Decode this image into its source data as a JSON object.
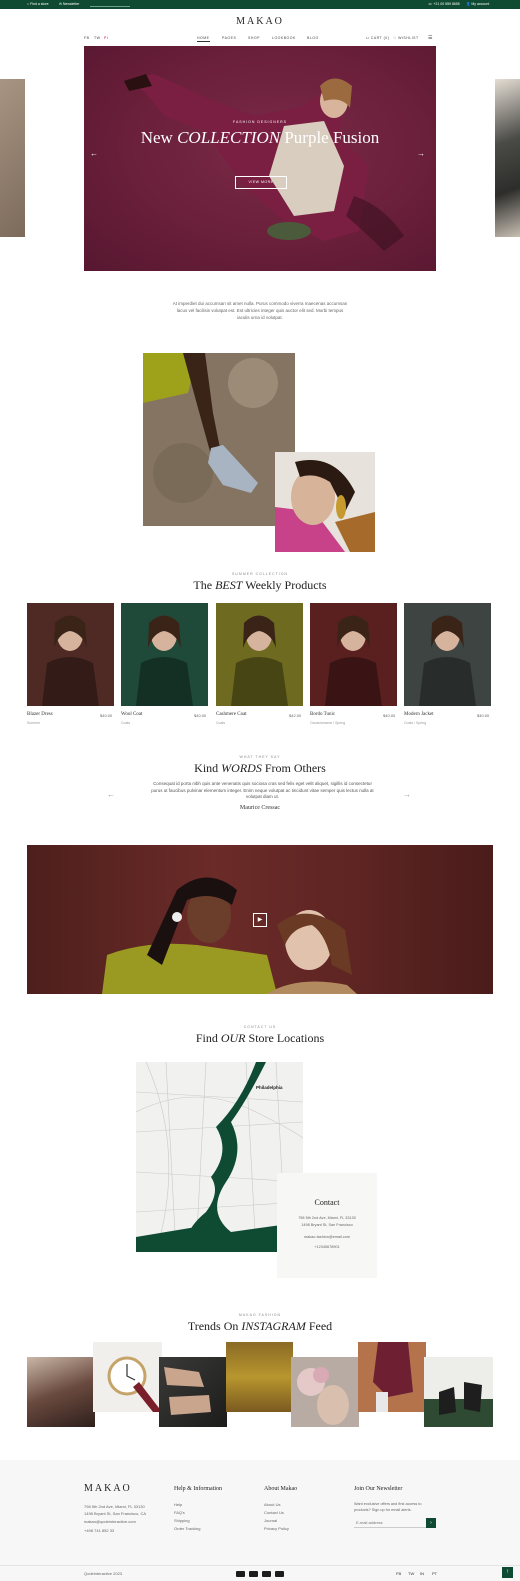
{
  "topbar": {
    "find_store": "Find a store",
    "newsletter": "Newsletter",
    "phone": "+21 00 559 8655",
    "account": "My account"
  },
  "brand": {
    "logo": "MAKAO"
  },
  "social_top": [
    "FB",
    "TW",
    "PI"
  ],
  "nav": [
    "HOME",
    "PAGES",
    "SHOP",
    "LOOKBOOK",
    "BLOG"
  ],
  "header_actions": {
    "cart": "CART (0)",
    "wishlist": "WISHLIST"
  },
  "hero": {
    "kicker": "FASHION DESIGNERS",
    "title_a": "New ",
    "title_em": "COLLECTION",
    "title_b": " Purple Fusion",
    "button": "VIEW MORE"
  },
  "intro_text": "At imperdiet dui accumsan sit amet nulla. Purus commodo viverra maecenas accumsan lacus vel facilisis volutpat est. Est ultricies integer quis auctor elit sed. Morbi tempus iaculis urna id volutpat.",
  "products_section": {
    "kicker": "SUMMER COLLECTION",
    "title_a": "The ",
    "title_em": "BEST",
    "title_b": " Weekly Products",
    "items": [
      {
        "name": "Blazer Dress",
        "price": "$40.00",
        "cat": "Summer",
        "bg": "#4f2a24"
      },
      {
        "name": "Wool Coat",
        "price": "$40.00",
        "cat": "Coats",
        "bg": "#1f4a3a"
      },
      {
        "name": "Cashmere Coat",
        "price": "$42.00",
        "cat": "Coats",
        "bg": "#6e6a1f"
      },
      {
        "name": "Bordo Tunic",
        "price": "$40.00",
        "cat": "Occasionwear / Spring",
        "bg": "#5a1f1f"
      },
      {
        "name": "Modern Jacket",
        "price": "$40.00",
        "cat": "Coats / Spring",
        "bg": "#3e4441"
      }
    ]
  },
  "testimonial": {
    "kicker": "WHAT THEY SAY",
    "title_a": "Kind ",
    "title_em": "WORDS",
    "title_b": " From Others",
    "quote": "Consequat id porta nibh quis ante venenatis quis sociosa cras sed felis eget velit aliquet, sigillis id consectetur purus ut faucibus pulvinar elementum integer. Enim neque volutpat ac tincidunt vitae semper quis lectus nulla at volutpat diam ut.",
    "author": "Maurice Cressac"
  },
  "stores": {
    "kicker": "CONTACT US",
    "title_a": "Find ",
    "title_em": "OUR",
    "title_b": " Store Locations",
    "map_label": "Philadelphia",
    "contact_title": "Contact",
    "address1": "798 5th 2nd Ave, Miami, FL 33130",
    "address2": "1498 Bryant St, San Francisco",
    "email": "makao-fashion@email.com",
    "phone": "+12345678901"
  },
  "instagram": {
    "kicker": "MAKAO FASHION",
    "title_a": "Trends On ",
    "title_em": "INSTAGRAM",
    "title_b": " Feed"
  },
  "footer": {
    "logo": "MAKAO",
    "addr1": "798 5th 2nd Ave, Miami, FL 33130",
    "addr2": "1498 Bryant St, San Francisco, CA",
    "email": "makao@qodeinteractive.com",
    "phone": "+498 741 852 33",
    "help_title": "Help & Information",
    "help_links": [
      "Help",
      "FAQ's",
      "Shipping",
      "Order Tracking"
    ],
    "about_title": "About Makao",
    "about_links": [
      "About Us",
      "Contact Us",
      "Journal",
      "Privacy Policy"
    ],
    "newsletter_title": "Join Our Newsletter",
    "newsletter_text": "Want exclusive offers and first access to products? Sign up for email alerts.",
    "email_placeholder": "E-mail address",
    "copyright": "Qodeinteractive 2023",
    "social": [
      "FB",
      "TW",
      "IN",
      "PT"
    ]
  },
  "colors": {
    "brand_green": "#0f4a33",
    "hero_bg": "#6a1f3a"
  }
}
